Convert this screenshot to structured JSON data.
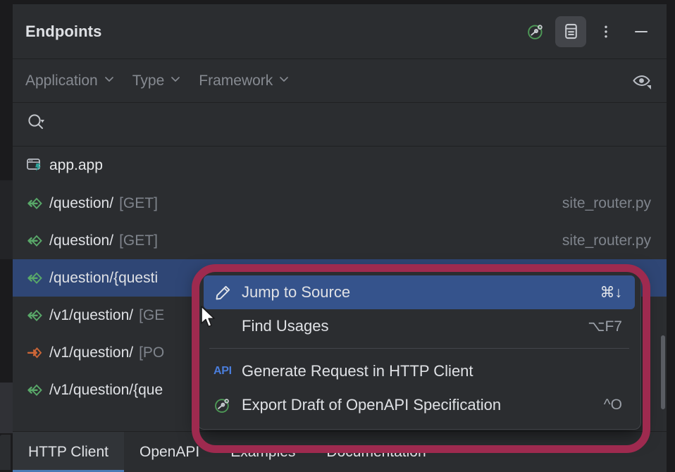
{
  "header": {
    "title": "Endpoints",
    "actions": [
      {
        "name": "openapi-spec-icon",
        "label": "Export Draft of OpenAPI Specification"
      },
      {
        "name": "preview-panel-icon",
        "label": "Show Preview Panel"
      },
      {
        "name": "more-options-icon",
        "label": "More Options"
      },
      {
        "name": "minimize-icon",
        "label": "Hide"
      }
    ]
  },
  "filters": [
    {
      "label": "Application"
    },
    {
      "label": "Type"
    },
    {
      "label": "Framework"
    }
  ],
  "filter_eye": {
    "name": "eye-icon",
    "label": "Show / Hide"
  },
  "search": {
    "placeholder": "",
    "value": "",
    "icon": "search-icon"
  },
  "list": {
    "group": {
      "label": "app.app",
      "icon": "module-icon"
    },
    "rows": [
      {
        "path": "/question/",
        "method": "[GET]",
        "method_kind": "get",
        "file": "site_router.py",
        "selected": false
      },
      {
        "path": "/question/",
        "method": "[GET]",
        "method_kind": "get",
        "file": "site_router.py",
        "selected": false
      },
      {
        "path": "/question/{questi",
        "method": "",
        "method_kind": "get",
        "file": "",
        "selected": true
      },
      {
        "path": "/v1/question/",
        "method": "[GE",
        "method_kind": "get",
        "file": "",
        "selected": false
      },
      {
        "path": "/v1/question/",
        "method": "[PO",
        "method_kind": "post",
        "file": "",
        "selected": false
      },
      {
        "path": "/v1/question/{que",
        "method": "",
        "method_kind": "get",
        "file": "",
        "selected": false
      }
    ]
  },
  "context_menu": {
    "items": [
      {
        "label": "Jump to Source",
        "shortcut": "⌘↓",
        "icon": "pencil-icon",
        "highlighted": true
      },
      {
        "label": "Find Usages",
        "shortcut": "⌥F7",
        "icon": "none",
        "highlighted": false
      },
      {
        "separator": true
      },
      {
        "label": "Generate Request in HTTP Client",
        "shortcut": "",
        "icon": "api-icon",
        "highlighted": false
      },
      {
        "label": "Export Draft of OpenAPI Specification",
        "shortcut": "^O",
        "icon": "openapi-icon",
        "highlighted": false
      }
    ]
  },
  "tabs": [
    {
      "label": "HTTP Client",
      "selected": true
    },
    {
      "label": "OpenAPI",
      "selected": false
    },
    {
      "label": "Examples",
      "selected": false
    },
    {
      "label": "Documentation",
      "selected": false
    }
  ],
  "colors": {
    "background": "#2b2d30",
    "selection": "#2f4675",
    "menu_highlight": "#35538c",
    "annotation_ring": "#9e2a4f",
    "get_method": "#59a869",
    "post_method": "#d2703a",
    "api_blue": "#4a7ddb"
  }
}
